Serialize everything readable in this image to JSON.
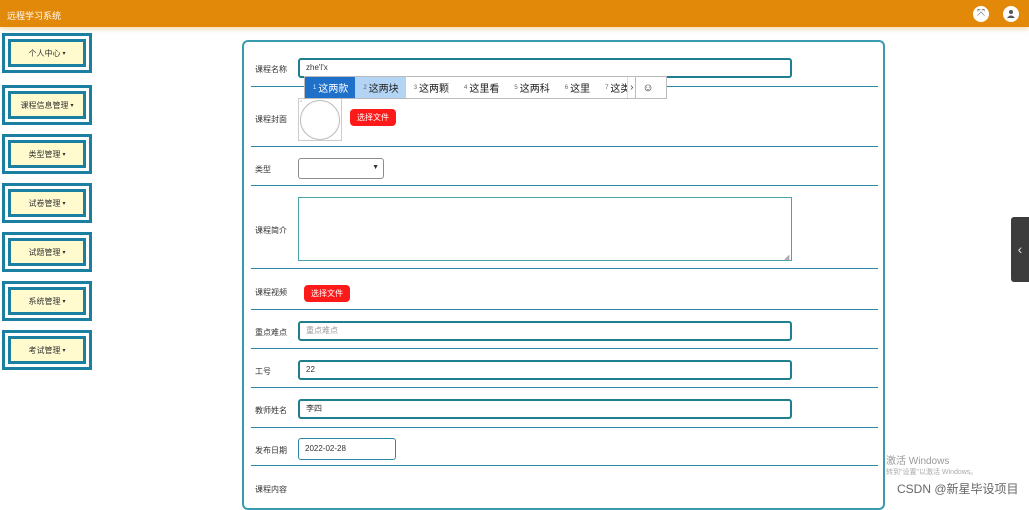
{
  "app": {
    "title": "远程学习系统"
  },
  "topbar": {
    "left_icon": "fullscreen-icon",
    "right_icon": "user-icon"
  },
  "sidebar": {
    "items": [
      {
        "label": "个人中心"
      },
      {
        "label": "课程信息管理"
      },
      {
        "label": "类型管理"
      },
      {
        "label": "试卷管理"
      },
      {
        "label": "试题管理"
      },
      {
        "label": "系统管理"
      },
      {
        "label": "考试管理"
      }
    ]
  },
  "form": {
    "course_name": {
      "label": "课程名称",
      "value": "zhe'l'x"
    },
    "cover": {
      "label": "课程封面",
      "button": "选择文件"
    },
    "type": {
      "label": "类型",
      "value": ""
    },
    "intro": {
      "label": "课程简介",
      "value": ""
    },
    "video": {
      "label": "课程视频",
      "button": "选择文件"
    },
    "key_points": {
      "label": "重点难点",
      "placeholder": "重点难点"
    },
    "job_no": {
      "label": "工号",
      "value": "22"
    },
    "teacher_name": {
      "label": "教师姓名",
      "value": "李四"
    },
    "publish_date": {
      "label": "发布日期",
      "value": "2022-02-28"
    },
    "content": {
      "label": "课程内容"
    }
  },
  "ime": {
    "candidates": [
      {
        "num": "1",
        "text": "这两款"
      },
      {
        "num": "2",
        "text": "这两块"
      },
      {
        "num": "3",
        "text": "这两颗"
      },
      {
        "num": "4",
        "text": "这里看"
      },
      {
        "num": "5",
        "text": "这两科"
      },
      {
        "num": "6",
        "text": "这里"
      },
      {
        "num": "7",
        "text": "这类"
      }
    ],
    "emoji": "☺"
  },
  "watermark": {
    "line1": "激活 Windows",
    "line2": "转到\"设置\"以激活 Windows。",
    "credit": "CSDN @新星毕设项目"
  },
  "colors": {
    "topbar": "#e3890a",
    "accent": "#1a7fa0",
    "danger": "#ff1a1a"
  }
}
